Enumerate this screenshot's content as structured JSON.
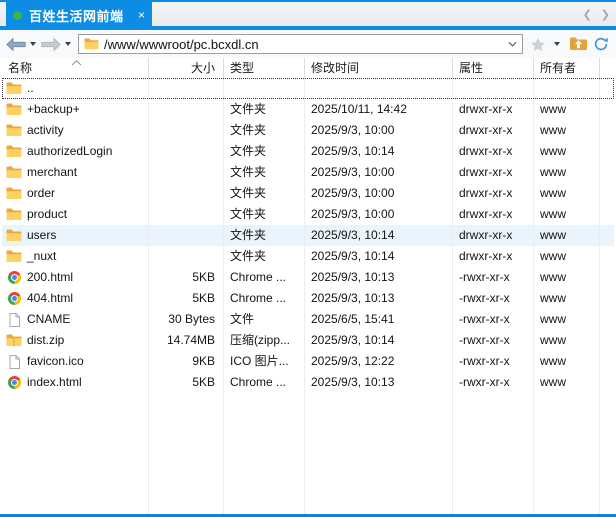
{
  "colors": {
    "accent_blue": "#0d8ce4",
    "bottom_bar_blue": "#0f82d9",
    "selection_blue": "#e9f4fc",
    "status_green": "#3cb448"
  },
  "tab_bar": {
    "active_tab": {
      "title": "百姓生活网前端",
      "close_label": "×"
    },
    "scroll_left_icon": "❮",
    "scroll_right_icon": "❯"
  },
  "toolbar": {
    "address": {
      "value": "/www/wwwroot/pc.bcxdl.cn"
    }
  },
  "file_table": {
    "columns": [
      {
        "key": "name",
        "label": "名称",
        "sort": "asc"
      },
      {
        "key": "size",
        "label": "大小"
      },
      {
        "key": "type",
        "label": "类型"
      },
      {
        "key": "modified",
        "label": "修改时间"
      },
      {
        "key": "attrs",
        "label": "属性"
      },
      {
        "key": "owner",
        "label": "所有者"
      }
    ],
    "rows": [
      {
        "icon": "folder",
        "name": "..",
        "size": "",
        "type": "",
        "modified": "",
        "attrs": "",
        "owner": "",
        "focused": true
      },
      {
        "icon": "folder",
        "name": "+backup+",
        "size": "",
        "type": "文件夹",
        "modified": "2025/10/11, 14:42",
        "attrs": "drwxr-xr-x",
        "owner": "www"
      },
      {
        "icon": "folder",
        "name": "activity",
        "size": "",
        "type": "文件夹",
        "modified": "2025/9/3, 10:00",
        "attrs": "drwxr-xr-x",
        "owner": "www"
      },
      {
        "icon": "folder",
        "name": "authorizedLogin",
        "size": "",
        "type": "文件夹",
        "modified": "2025/9/3, 10:14",
        "attrs": "drwxr-xr-x",
        "owner": "www"
      },
      {
        "icon": "folder",
        "name": "merchant",
        "size": "",
        "type": "文件夹",
        "modified": "2025/9/3, 10:00",
        "attrs": "drwxr-xr-x",
        "owner": "www"
      },
      {
        "icon": "folder",
        "name": "order",
        "size": "",
        "type": "文件夹",
        "modified": "2025/9/3, 10:00",
        "attrs": "drwxr-xr-x",
        "owner": "www"
      },
      {
        "icon": "folder",
        "name": "product",
        "size": "",
        "type": "文件夹",
        "modified": "2025/9/3, 10:00",
        "attrs": "drwxr-xr-x",
        "owner": "www"
      },
      {
        "icon": "folder",
        "name": "users",
        "size": "",
        "type": "文件夹",
        "modified": "2025/9/3, 10:14",
        "attrs": "drwxr-xr-x",
        "owner": "www",
        "highlighted": true
      },
      {
        "icon": "folder",
        "name": "_nuxt",
        "size": "",
        "type": "文件夹",
        "modified": "2025/9/3, 10:14",
        "attrs": "drwxr-xr-x",
        "owner": "www"
      },
      {
        "icon": "chrome",
        "name": "200.html",
        "size": "5KB",
        "type": "Chrome ...",
        "modified": "2025/9/3, 10:13",
        "attrs": "-rwxr-xr-x",
        "owner": "www"
      },
      {
        "icon": "chrome",
        "name": "404.html",
        "size": "5KB",
        "type": "Chrome ...",
        "modified": "2025/9/3, 10:13",
        "attrs": "-rwxr-xr-x",
        "owner": "www"
      },
      {
        "icon": "file",
        "name": "CNAME",
        "size": "30 Bytes",
        "type": "文件",
        "modified": "2025/6/5, 15:41",
        "attrs": "-rwxr-xr-x",
        "owner": "www"
      },
      {
        "icon": "zip",
        "name": "dist.zip",
        "size": "14.74MB",
        "type": "压缩(zipp...",
        "modified": "2025/9/3, 10:14",
        "attrs": "-rwxr-xr-x",
        "owner": "www"
      },
      {
        "icon": "file",
        "name": "favicon.ico",
        "size": "9KB",
        "type": "ICO 图片...",
        "modified": "2025/9/3, 12:22",
        "attrs": "-rwxr-xr-x",
        "owner": "www"
      },
      {
        "icon": "chrome",
        "name": "index.html",
        "size": "5KB",
        "type": "Chrome ...",
        "modified": "2025/9/3, 10:13",
        "attrs": "-rwxr-xr-x",
        "owner": "www"
      }
    ]
  }
}
